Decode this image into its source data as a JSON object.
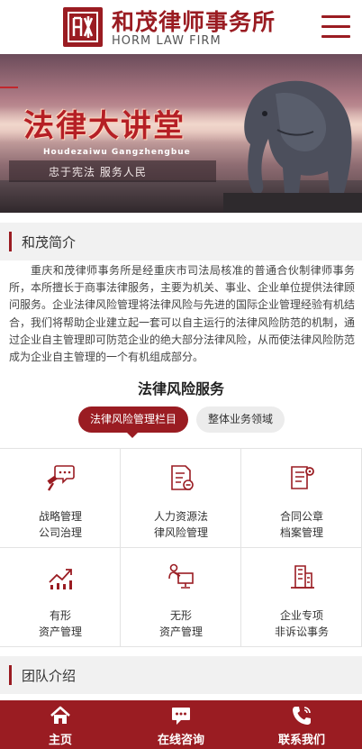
{
  "header": {
    "logo_cn": "和茂律师事务所",
    "logo_en": "HORM LAW FIRM",
    "menu_icon": "hamburger-menu-icon",
    "brand_color": "#9a1c22"
  },
  "banner": {
    "title": "法律大讲堂",
    "pinyin": "Houdezaiwu   Gangzhengbue",
    "slogan": "忠于宪法  服务人民"
  },
  "intro": {
    "heading": "和茂简介",
    "text": "重庆和茂律师事务所是经重庆市司法局核准的普通合伙制律师事务所，本所擅长于商事法律服务，主要为机关、事业、企业单位提供法律顾问服务。企业法律风险管理将法律风险与先进的国际企业管理经验有机结合，我们将帮助企业建立起一套可以自主运行的法律风险防范的机制，通过企业自主管理即可防范企业的绝大部分法律风险，从而使法律风险防范成为企业自主管理的一个有机组成部分。"
  },
  "services": {
    "title": "法律风险服务",
    "tabs": [
      {
        "label": "法律风险管理栏目",
        "active": true
      },
      {
        "label": "整体业务领域",
        "active": false
      }
    ],
    "items": [
      {
        "line1": "战略管理",
        "line2": "公司治理",
        "icon": "gavel-chat-icon"
      },
      {
        "line1": "人力资源法",
        "line2": "律风险管理",
        "icon": "document-user-icon"
      },
      {
        "line1": "合同公章",
        "line2": "档案管理",
        "icon": "document-gear-icon"
      },
      {
        "line1": "有形",
        "line2": "资产管理",
        "icon": "growth-chart-icon"
      },
      {
        "line1": "无形",
        "line2": "资产管理",
        "icon": "presenter-screen-icon"
      },
      {
        "line1": "企业专项",
        "line2": "非诉讼事务",
        "icon": "buildings-icon"
      }
    ]
  },
  "team": {
    "heading": "团队介绍"
  },
  "bottom_nav": [
    {
      "label": "主页",
      "icon": "home-icon"
    },
    {
      "label": "在线咨询",
      "icon": "chat-bubble-icon"
    },
    {
      "label": "联系我们",
      "icon": "phone-icon"
    }
  ]
}
